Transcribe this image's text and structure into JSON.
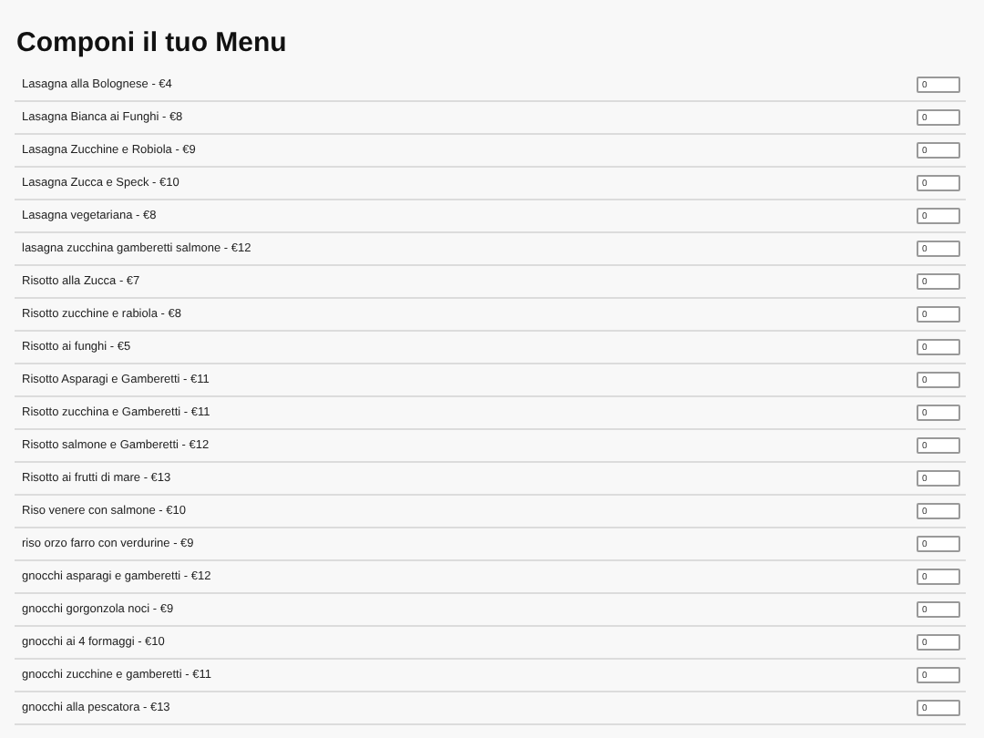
{
  "title": "Componi il tuo Menu",
  "items": [
    {
      "label": "Lasagna alla Bolognese - €4",
      "quantity": "0"
    },
    {
      "label": "Lasagna Bianca ai Funghi - €8",
      "quantity": "0"
    },
    {
      "label": "Lasagna Zucchine e Robiola - €9",
      "quantity": "0"
    },
    {
      "label": "Lasagna Zucca e Speck - €10",
      "quantity": "0"
    },
    {
      "label": "Lasagna vegetariana - €8",
      "quantity": "0"
    },
    {
      "label": "lasagna zucchina gamberetti salmone - €12",
      "quantity": "0"
    },
    {
      "label": "Risotto alla Zucca - €7",
      "quantity": "0"
    },
    {
      "label": "Risotto zucchine e rabiola - €8",
      "quantity": "0"
    },
    {
      "label": "Risotto ai funghi - €5",
      "quantity": "0"
    },
    {
      "label": "Risotto Asparagi e Gamberetti - €11",
      "quantity": "0"
    },
    {
      "label": "Risotto zucchina e Gamberetti - €11",
      "quantity": "0"
    },
    {
      "label": "Risotto salmone e Gamberetti - €12",
      "quantity": "0"
    },
    {
      "label": "Risotto ai frutti di mare - €13",
      "quantity": "0"
    },
    {
      "label": "Riso venere con salmone - €10",
      "quantity": "0"
    },
    {
      "label": "riso orzo farro con verdurine - €9",
      "quantity": "0"
    },
    {
      "label": "gnocchi asparagi e gamberetti - €12",
      "quantity": "0"
    },
    {
      "label": "gnocchi gorgonzola noci - €9",
      "quantity": "0"
    },
    {
      "label": "gnocchi ai 4 formaggi - €10",
      "quantity": "0"
    },
    {
      "label": "gnocchi zucchine e gamberetti - €11",
      "quantity": "0"
    },
    {
      "label": "gnocchi alla pescatora - €13",
      "quantity": "0"
    }
  ]
}
